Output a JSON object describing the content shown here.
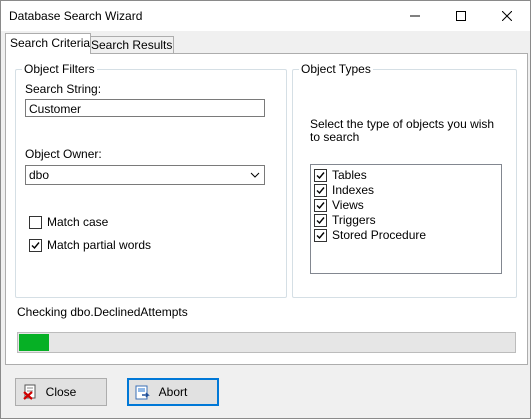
{
  "window": {
    "title": "Database Search Wizard"
  },
  "tabs": [
    {
      "label": "Search Criteria",
      "active": true
    },
    {
      "label": "Search Results",
      "active": false
    }
  ],
  "object_filters": {
    "group_label": "Object Filters",
    "search_string_label": "Search String:",
    "search_string_value": "Customer",
    "owner_label": "Object Owner:",
    "owner_value": "dbo",
    "match_case": {
      "label": "Match case",
      "checked": false
    },
    "match_partial": {
      "label": "Match partial words",
      "checked": true
    }
  },
  "object_types": {
    "group_label": "Object Types",
    "instruction": "Select the type of objects you wish to search",
    "items": [
      {
        "label": "Tables",
        "checked": true
      },
      {
        "label": "Indexes",
        "checked": true
      },
      {
        "label": "Views",
        "checked": true
      },
      {
        "label": "Triggers",
        "checked": true
      },
      {
        "label": "Stored Procedure",
        "checked": true
      }
    ]
  },
  "status": {
    "text": "Checking dbo.DeclinedAttempts",
    "progress": 0.065
  },
  "buttons": {
    "close": "Close",
    "abort": "Abort"
  },
  "colors": {
    "progress_fill": "#06b025",
    "focus_border": "#0078d7"
  },
  "icons": {
    "close": "close-report-icon",
    "abort": "abort-icon"
  }
}
